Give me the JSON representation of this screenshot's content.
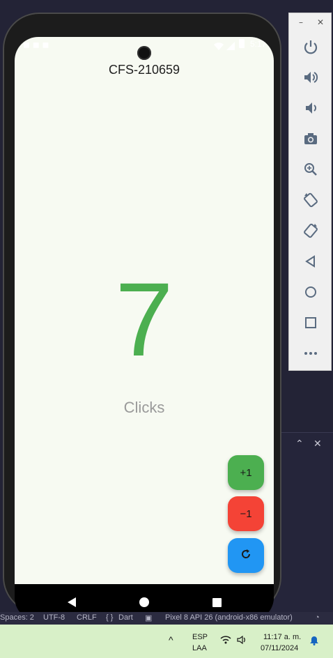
{
  "device": {
    "app_title": "CFS-210659",
    "status_time": "5:17",
    "counter_value": "7",
    "counter_label": "Clicks",
    "fab_increment": "+1",
    "fab_decrement": "−1",
    "fab_reset_icon": "refresh-icon"
  },
  "colors": {
    "counter": "#4caf50",
    "increment": "#4caf50",
    "decrement": "#f44336",
    "reset": "#2196f3",
    "app_bg": "#f7faf2",
    "taskbar": "#d8f0c8"
  },
  "emulator_toolbar": {
    "window_controls": [
      "–",
      "✕"
    ],
    "icons": [
      "power-icon",
      "volume-up-icon",
      "volume-down-icon",
      "camera-icon",
      "zoom-icon",
      "rotate-left-icon",
      "rotate-right-icon",
      "back-icon",
      "home-icon",
      "overview-icon",
      "more-icon"
    ]
  },
  "ide_panel": {
    "controls": [
      "⌃",
      "✕"
    ]
  },
  "ide_status": {
    "spaces": "Spaces: 2",
    "encoding": "UTF-8",
    "line_endings": "CRLF",
    "language": "Dart",
    "device": "Pixel 8 API 26 (android-x86 emulator)"
  },
  "taskbar": {
    "lang_top": "ESP",
    "lang_bottom": "LAA",
    "time": "11:17 a. m.",
    "date": "07/11/2024"
  }
}
